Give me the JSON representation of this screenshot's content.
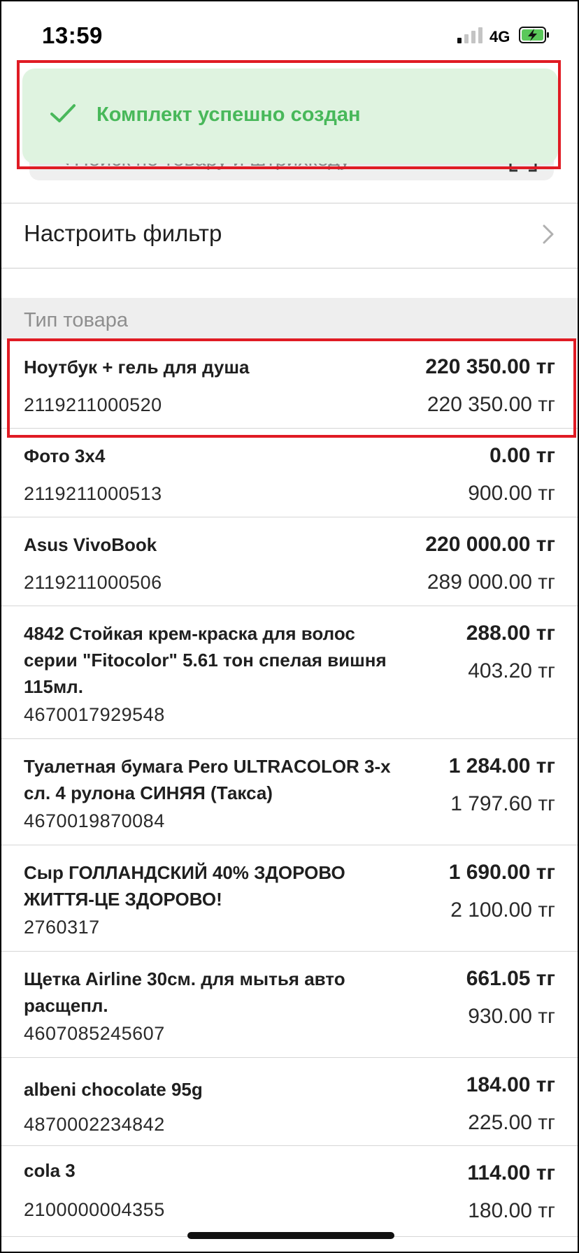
{
  "status_bar": {
    "time": "13:59",
    "network": "4G"
  },
  "search": {
    "placeholder": "Поиск по товару и штрихкоду"
  },
  "toast": {
    "message": "Комплект успешно создан"
  },
  "filter": {
    "label": "Настроить фильтр"
  },
  "section": {
    "title": "Тип товара"
  },
  "products": [
    {
      "name": "Ноутбук + гель для душа",
      "code": "2119211000520",
      "price": "220 350.00 тг",
      "old_price": "220 350.00 тг"
    },
    {
      "name": "Фото 3x4",
      "code": "2119211000513",
      "price": "0.00 тг",
      "old_price": "900.00 тг"
    },
    {
      "name": "Asus VivoBook",
      "code": "2119211000506",
      "price": "220 000.00 тг",
      "old_price": "289 000.00 тг"
    },
    {
      "name": "4842 Стойкая крем-краска для волос серии \"Fitocolor\" 5.61 тон спелая вишня 115мл.",
      "code": "4670017929548",
      "price": "288.00 тг",
      "old_price": "403.20 тг"
    },
    {
      "name": "Туалетная бумага Pero ULTRACOLOR 3-х сл. 4 рулона СИНЯЯ (Такса)",
      "code": "4670019870084",
      "price": "1 284.00 тг",
      "old_price": "1 797.60 тг"
    },
    {
      "name": "Сыр ГОЛЛАНДСКИЙ 40% ЗДОРОВО ЖИТТЯ-ЦЕ ЗДОРОВО!",
      "code": "2760317",
      "price": "1 690.00 тг",
      "old_price": "2 100.00 тг"
    },
    {
      "name": "Щетка Airline 30см. для мытья авто расщепл.",
      "code": "4607085245607",
      "price": "661.05 тг",
      "old_price": "930.00 тг"
    },
    {
      "name": "albeni chocolate 95g",
      "code": "4870002234842",
      "price": "184.00 тг",
      "old_price": "225.00 тг"
    },
    {
      "name": "cola 3",
      "code": "2100000004355",
      "price": "114.00 тг",
      "old_price": "180.00 тг"
    }
  ],
  "colors": {
    "toast_bg": "#dff3e0",
    "toast_text": "#48b85a",
    "highlight": "#e01b24",
    "section_bg": "#eeeeee"
  },
  "icons": [
    "search-icon",
    "barcode-scan-icon",
    "check-icon",
    "chevron-right-icon",
    "signal-icon",
    "battery-charging-icon"
  ]
}
